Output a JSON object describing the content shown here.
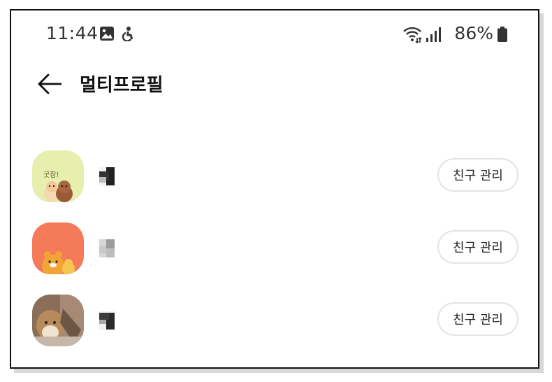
{
  "status_bar": {
    "time": "11:44",
    "battery_percent": "86%",
    "icons": [
      "image-icon",
      "accessibility-icon",
      "wifi-icon",
      "signal-icon",
      "battery-icon"
    ]
  },
  "header": {
    "title": "멀티프로필"
  },
  "profiles": [
    {
      "avatar": "avatar-1",
      "button_label": "친구 관리",
      "avatar_color": "#e8f0b0",
      "avatar_text": "굿잠!"
    },
    {
      "avatar": "avatar-2",
      "button_label": "친구 관리",
      "avatar_color": "#f47a5a"
    },
    {
      "avatar": "avatar-3",
      "button_label": "친구 관리",
      "avatar_color": "#8a6e5a"
    }
  ]
}
